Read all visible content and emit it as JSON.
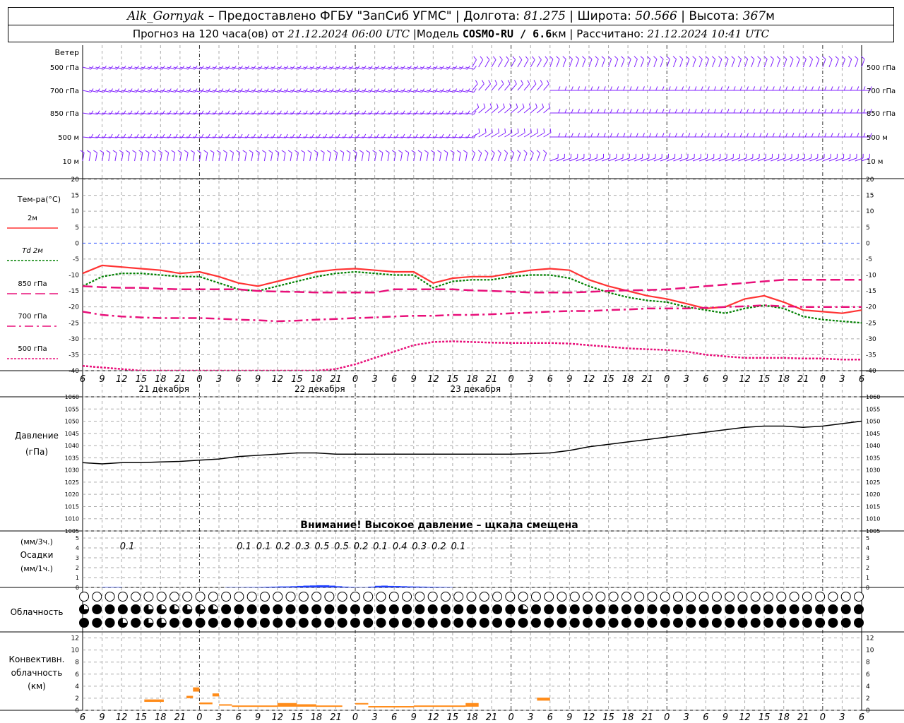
{
  "header": {
    "station": "Alk_Gornyak",
    "dash": " – ",
    "provider": "Предоставлено ФГБУ \"ЗапСиб УГМС\"",
    "sep": " | ",
    "lon_label": "Долгота: ",
    "lon": "81.275",
    "lat_label": "Широта: ",
    "lat": "50.566",
    "alt_label": "Высота: ",
    "alt": "367",
    "alt_unit": "м",
    "forecast_label": "Прогноз на 120 часа(ов) от ",
    "forecast_time": "21.12.2024 06:00 UTC",
    "model_label": "  |Модель ",
    "model": "COSMO-RU / 6.6",
    "model_unit": "км",
    "calc_label": "Рассчитано: ",
    "calc_time": "21.12.2024 10:41 UTC"
  },
  "labels": {
    "wind": "Ветер",
    "wind_levels": [
      "500 гПа",
      "700 гПа",
      "850 гПа",
      "500 м",
      "10 м"
    ],
    "temp_title": "Тем-ра(°C)",
    "temp_legend": [
      "2м",
      "Td  2м",
      "850 гПа",
      "700 гПа",
      "500 гПа"
    ],
    "pressure_title": "Давление",
    "pressure_unit": "(гПа)",
    "pressure_warning": "Внимание! Высокое давление – щкала смещена",
    "precip_3h": "(мм/3ч.)",
    "precip_title": "Осадки",
    "precip_1h": "(мм/1ч.)",
    "cloud_title": "Облачность",
    "conv_title": [
      "Конвективн.",
      "облачность",
      "(км)"
    ],
    "days": [
      "21 декабря",
      "22 декабря",
      "23 декабря"
    ]
  },
  "colors": {
    "t2m": "#ff3333",
    "td2m": "#008000",
    "t850": "#e8107a",
    "t700": "#e8107a",
    "t500": "#e8107a",
    "wind": "#8020ff",
    "precip": "#1f3fff",
    "convective": "#ff8c1a",
    "zero_line": "#3355ff"
  },
  "chart_data": [
    {
      "type": "line",
      "name": "wind",
      "levels": [
        "500 гПа",
        "700 гПа",
        "850 гПа",
        "500 м",
        "10 м"
      ]
    },
    {
      "type": "line",
      "name": "temperature",
      "x_hours": [
        0,
        3,
        6,
        9,
        12,
        15,
        18,
        21,
        24,
        27,
        30,
        33,
        36,
        39,
        42,
        45,
        48,
        51,
        54,
        57,
        60,
        63,
        66,
        69,
        72,
        75,
        78,
        81,
        84,
        87,
        90,
        93,
        96,
        99,
        102,
        105,
        108,
        111,
        114,
        117,
        120
      ],
      "x_ticks": [
        "6",
        "9",
        "12",
        "15",
        "18",
        "21",
        "0",
        "3",
        "6",
        "9",
        "12",
        "15",
        "18",
        "21",
        "0",
        "3",
        "6",
        "9",
        "12",
        "15",
        "18",
        "21",
        "0",
        "3",
        "6",
        "9",
        "12",
        "15",
        "18",
        "21",
        "0",
        "3",
        "6",
        "9",
        "12",
        "15",
        "18",
        "21",
        "0",
        "3",
        "6",
        "9",
        "12"
      ],
      "ylim": [
        -40,
        20
      ],
      "yticks": [
        20,
        15,
        10,
        5,
        0,
        -5,
        -10,
        -15,
        -20,
        -25,
        -30,
        -35,
        -40
      ],
      "series": [
        {
          "name": "2м",
          "values": [
            -9.5,
            -7,
            -7.5,
            -8,
            -8.5,
            -9.5,
            -9,
            -10.5,
            -12.5,
            -13.5,
            -12,
            -10.5,
            -9,
            -8.3,
            -8,
            -8.5,
            -9,
            -9,
            -12.5,
            -11,
            -10.5,
            -10.5,
            -9.5,
            -8.5,
            -8,
            -8.5,
            -11.5,
            -13.5,
            -15,
            -16.5,
            -17.5,
            -19,
            -20.5,
            -20,
            -17.5,
            -16.5,
            -18.5,
            -21,
            -21.5,
            -22,
            -21
          ]
        },
        {
          "name": "Td  2м",
          "values": [
            -13.5,
            -10.5,
            -9.5,
            -9.5,
            -10,
            -10.5,
            -10.5,
            -12.5,
            -14.5,
            -15,
            -13.5,
            -12,
            -10.5,
            -9.5,
            -9,
            -9.5,
            -10,
            -10,
            -14,
            -12,
            -11.5,
            -11.5,
            -10.5,
            -10,
            -10,
            -11,
            -13.5,
            -15.5,
            -17,
            -18,
            -18.5,
            -20,
            -21,
            -22,
            -20.5,
            -19.5,
            -20.5,
            -23,
            -24,
            -24.5,
            -25
          ]
        },
        {
          "name": "850 гПа",
          "values": [
            -13.5,
            -13.8,
            -14,
            -14,
            -14.3,
            -14.5,
            -14.5,
            -14.5,
            -14.5,
            -15,
            -15.2,
            -15.3,
            -15.5,
            -15.5,
            -15.5,
            -15.5,
            -14.5,
            -14.5,
            -14.5,
            -14.5,
            -14.8,
            -15,
            -15.2,
            -15.5,
            -15.5,
            -15.5,
            -15.3,
            -15,
            -14.8,
            -14.7,
            -14.5,
            -14,
            -13.5,
            -13,
            -12.5,
            -12,
            -11.5,
            -11.5,
            -11.5,
            -11.5,
            -11.5
          ]
        },
        {
          "name": "700 гПа",
          "values": [
            -21.5,
            -22.5,
            -23,
            -23.3,
            -23.5,
            -23.5,
            -23.5,
            -23.7,
            -24,
            -24.2,
            -24.5,
            -24.3,
            -24,
            -23.8,
            -23.5,
            -23.3,
            -23,
            -22.8,
            -22.8,
            -22.5,
            -22.5,
            -22.3,
            -22,
            -21.8,
            -21.5,
            -21.3,
            -21.3,
            -21,
            -20.8,
            -20.5,
            -20.5,
            -20.5,
            -20.3,
            -20,
            -19.8,
            -19.5,
            -19.8,
            -20,
            -20,
            -20,
            -20
          ]
        },
        {
          "name": "500 гПа",
          "values": [
            -38.5,
            -39,
            -39.5,
            -40.5,
            -41,
            -42,
            -42.5,
            -42.5,
            -42.5,
            -42.5,
            -42,
            -41.5,
            -40.5,
            -39.5,
            -38,
            -36,
            -34,
            -32,
            -31,
            -30.8,
            -31,
            -31.2,
            -31.3,
            -31.3,
            -31.3,
            -31.5,
            -32,
            -32.5,
            -33,
            -33.3,
            -33.5,
            -34,
            -35,
            -35.5,
            -36,
            -36,
            -36,
            -36.2,
            -36.2,
            -36.5,
            -36.5
          ]
        }
      ]
    },
    {
      "type": "line",
      "name": "pressure",
      "ylim": [
        1005,
        1060
      ],
      "yticks": [
        1060,
        1055,
        1050,
        1045,
        1040,
        1035,
        1030,
        1025,
        1020,
        1015,
        1010,
        1005
      ],
      "x_hours": [
        0,
        3,
        6,
        9,
        12,
        15,
        18,
        21,
        24,
        27,
        30,
        33,
        36,
        39,
        42,
        45,
        48,
        51,
        54,
        57,
        60,
        63,
        66,
        69,
        72,
        75,
        78,
        81,
        84,
        87,
        90,
        93,
        96,
        99,
        102,
        105,
        108,
        111,
        114,
        117,
        120
      ],
      "values": [
        1033,
        1032.5,
        1033,
        1033,
        1033.3,
        1033.5,
        1034,
        1034.5,
        1035.5,
        1036,
        1036.5,
        1037,
        1037,
        1036.5,
        1036.5,
        1036.5,
        1036.5,
        1036.5,
        1036.5,
        1036.5,
        1036.5,
        1036.5,
        1036.5,
        1036.7,
        1037,
        1038,
        1039.5,
        1040.5,
        1041.5,
        1042.5,
        1043.5,
        1044.5,
        1045.5,
        1046.5,
        1047.5,
        1048,
        1048,
        1047.5,
        1048,
        1049,
        1050
      ]
    },
    {
      "type": "bar",
      "name": "precipitation",
      "ylim": [
        0,
        5
      ],
      "yticks": [
        5,
        4,
        3,
        2,
        1,
        0
      ],
      "labels_3h": [
        {
          "hour": 6,
          "text": "0.1"
        },
        {
          "hour": 24,
          "text": "0.1"
        },
        {
          "hour": 27,
          "text": "0.1"
        },
        {
          "hour": 30,
          "text": "0.2"
        },
        {
          "hour": 33,
          "text": "0.3"
        },
        {
          "hour": 36,
          "text": "0.5"
        },
        {
          "hour": 39,
          "text": "0.5"
        },
        {
          "hour": 42,
          "text": "0.2"
        },
        {
          "hour": 45,
          "text": "0.1"
        },
        {
          "hour": 48,
          "text": "0.4"
        },
        {
          "hour": 51,
          "text": "0.3"
        },
        {
          "hour": 54,
          "text": "0.2"
        },
        {
          "hour": 57,
          "text": "0.1"
        }
      ],
      "hourly": [
        {
          "hour": 4,
          "value": 0.04
        },
        {
          "hour": 5,
          "value": 0.04
        },
        {
          "hour": 6,
          "value": 0.04
        },
        {
          "hour": 23,
          "value": 0.03
        },
        {
          "hour": 24,
          "value": 0.03
        },
        {
          "hour": 25,
          "value": 0.03
        },
        {
          "hour": 26,
          "value": 0.04
        },
        {
          "hour": 27,
          "value": 0.04
        },
        {
          "hour": 28,
          "value": 0.05
        },
        {
          "hour": 29,
          "value": 0.07
        },
        {
          "hour": 30,
          "value": 0.08
        },
        {
          "hour": 31,
          "value": 0.1
        },
        {
          "hour": 32,
          "value": 0.1
        },
        {
          "hour": 33,
          "value": 0.12
        },
        {
          "hour": 34,
          "value": 0.15
        },
        {
          "hour": 35,
          "value": 0.18
        },
        {
          "hour": 36,
          "value": 0.2
        },
        {
          "hour": 37,
          "value": 0.22
        },
        {
          "hour": 38,
          "value": 0.22
        },
        {
          "hour": 39,
          "value": 0.18
        },
        {
          "hour": 40,
          "value": 0.12
        },
        {
          "hour": 41,
          "value": 0.08
        },
        {
          "hour": 42,
          "value": 0.05
        },
        {
          "hour": 43,
          "value": 0.03
        },
        {
          "hour": 44,
          "value": 0.03
        },
        {
          "hour": 45,
          "value": 0.08
        },
        {
          "hour": 46,
          "value": 0.16
        },
        {
          "hour": 47,
          "value": 0.18
        },
        {
          "hour": 48,
          "value": 0.15
        },
        {
          "hour": 49,
          "value": 0.14
        },
        {
          "hour": 50,
          "value": 0.12
        },
        {
          "hour": 51,
          "value": 0.1
        },
        {
          "hour": 52,
          "value": 0.09
        },
        {
          "hour": 53,
          "value": 0.08
        },
        {
          "hour": 54,
          "value": 0.07
        },
        {
          "hour": 55,
          "value": 0.06
        },
        {
          "hour": 56,
          "value": 0.05
        },
        {
          "hour": 57,
          "value": 0.04
        }
      ]
    },
    {
      "type": "table",
      "name": "cloudiness",
      "rows": 3,
      "tenths_per_hour": [
        [
          0,
          0,
          0,
          0,
          0,
          0,
          0,
          0,
          0,
          0,
          0,
          0,
          0,
          0,
          0,
          0,
          0,
          0,
          0,
          0,
          0,
          0,
          0,
          0,
          0,
          0,
          0,
          0,
          0,
          0,
          0,
          0,
          0,
          0,
          0,
          0,
          0,
          0,
          0,
          0,
          0,
          0,
          0,
          0,
          0,
          0,
          0,
          0,
          0,
          0,
          0,
          0,
          0,
          0,
          0,
          0,
          0,
          0,
          0,
          0,
          0,
          0,
          0,
          0,
          0,
          0,
          0,
          0,
          0,
          0,
          0,
          0,
          0,
          0,
          0,
          0,
          0,
          0,
          0,
          0,
          0,
          0,
          0,
          0,
          0,
          0,
          0,
          0,
          0,
          0,
          0,
          0,
          0,
          0,
          0,
          0,
          0,
          0,
          0,
          0,
          0,
          0,
          0,
          0,
          0,
          0,
          0,
          0,
          0,
          0,
          0,
          0,
          0,
          0,
          0,
          0,
          0,
          0,
          0,
          0,
          0
        ],
        [
          7,
          10,
          10,
          10,
          10,
          7,
          10,
          7,
          10,
          7,
          7,
          5,
          7,
          7,
          7,
          7,
          7,
          7,
          5,
          7,
          7,
          10,
          10,
          10,
          10,
          10,
          10,
          10,
          10,
          10,
          10,
          10,
          10,
          10,
          10,
          10,
          10,
          10,
          10,
          10,
          10,
          10,
          10,
          10,
          10,
          10,
          10,
          10,
          10,
          10,
          10,
          10,
          10,
          10,
          10,
          10,
          10,
          10,
          10,
          10,
          10,
          10,
          10,
          10,
          10,
          10,
          10,
          10,
          7,
          10,
          10,
          10,
          10,
          10,
          10,
          10,
          10,
          10,
          10,
          10,
          10,
          10,
          10,
          10,
          10,
          10,
          10,
          10,
          10,
          10,
          10,
          10,
          10,
          10,
          10,
          10,
          10,
          10,
          10,
          10,
          10,
          10,
          10,
          10,
          10,
          10,
          10,
          10,
          10,
          10,
          10,
          10,
          10,
          10,
          10,
          10,
          10,
          10,
          10,
          10,
          10
        ],
        [
          10,
          10,
          10,
          7,
          10,
          10,
          7,
          10,
          10,
          7,
          7,
          10,
          7,
          10,
          10,
          10,
          10,
          7,
          10,
          10,
          10,
          10,
          10,
          10,
          10,
          10,
          10,
          10,
          10,
          10,
          10,
          10,
          10,
          10,
          10,
          10,
          10,
          10,
          10,
          10,
          10,
          10,
          10,
          10,
          10,
          10,
          10,
          10,
          10,
          10,
          10,
          10,
          10,
          10,
          10,
          10,
          10,
          10,
          10,
          10,
          10,
          10,
          10,
          10,
          10,
          10,
          10,
          10,
          10,
          10,
          10,
          10,
          10,
          10,
          10,
          10,
          10,
          10,
          10,
          10,
          10,
          10,
          10,
          10,
          10,
          10,
          10,
          10,
          10,
          10,
          10,
          10,
          10,
          10,
          10,
          10,
          10,
          10,
          10,
          10,
          10,
          10,
          10,
          10,
          10,
          10,
          10,
          10,
          10,
          10,
          10,
          10,
          10,
          10,
          10,
          10,
          10,
          10,
          10,
          10,
          10
        ]
      ]
    },
    {
      "type": "bar",
      "name": "convective_cloudiness",
      "ylim": [
        0,
        13
      ],
      "yticks": [
        12,
        10,
        8,
        6,
        4,
        2,
        0
      ],
      "ranges": [
        {
          "from": 9.5,
          "to": 12.5,
          "bottom": 1.4,
          "top": 1.8
        },
        {
          "from": 16,
          "to": 17,
          "bottom": 2.0,
          "top": 2.4
        },
        {
          "from": 17,
          "to": 18,
          "bottom": 3.1,
          "top": 3.8
        },
        {
          "from": 18,
          "to": 20,
          "bottom": 1.0,
          "top": 1.3
        },
        {
          "from": 20,
          "to": 21,
          "bottom": 2.3,
          "top": 2.8
        },
        {
          "from": 21,
          "to": 23,
          "bottom": 0.8,
          "top": 1.0
        },
        {
          "from": 23,
          "to": 30,
          "bottom": 0.6,
          "top": 0.8
        },
        {
          "from": 30,
          "to": 33,
          "bottom": 0.6,
          "top": 1.2
        },
        {
          "from": 33,
          "to": 36,
          "bottom": 0.6,
          "top": 1.0
        },
        {
          "from": 36,
          "to": 40,
          "bottom": 0.6,
          "top": 0.8
        },
        {
          "from": 42,
          "to": 44,
          "bottom": 1.0,
          "top": 1.2
        },
        {
          "from": 44,
          "to": 51,
          "bottom": 0.6,
          "top": 0.7
        },
        {
          "from": 51,
          "to": 59,
          "bottom": 0.6,
          "top": 0.8
        },
        {
          "from": 59,
          "to": 61,
          "bottom": 0.6,
          "top": 1.2
        },
        {
          "from": 70,
          "to": 72,
          "bottom": 1.6,
          "top": 2.1
        }
      ]
    }
  ]
}
